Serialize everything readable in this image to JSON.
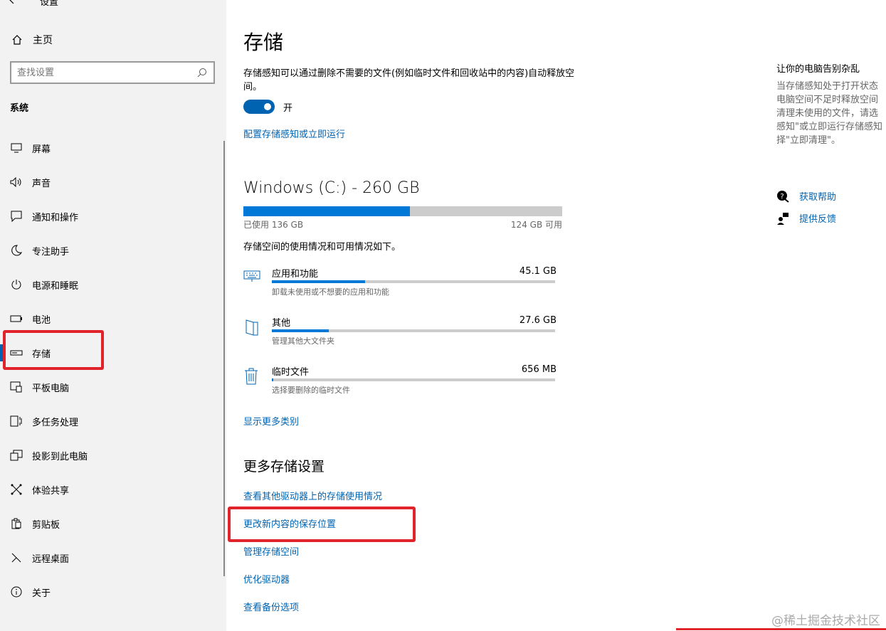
{
  "window": {
    "title": "设置"
  },
  "sidebar": {
    "home_label": "主页",
    "search_placeholder": "查找设置",
    "section_title": "系统",
    "items": [
      {
        "label": "屏幕",
        "icon": "monitor-icon"
      },
      {
        "label": "声音",
        "icon": "speaker-icon"
      },
      {
        "label": "通知和操作",
        "icon": "notification-icon"
      },
      {
        "label": "专注助手",
        "icon": "moon-icon"
      },
      {
        "label": "电源和睡眠",
        "icon": "power-icon"
      },
      {
        "label": "电池",
        "icon": "battery-icon"
      },
      {
        "label": "存储",
        "icon": "storage-icon",
        "active": true
      },
      {
        "label": "平板电脑",
        "icon": "tablet-icon"
      },
      {
        "label": "多任务处理",
        "icon": "multitask-icon"
      },
      {
        "label": "投影到此电脑",
        "icon": "project-icon"
      },
      {
        "label": "体验共享",
        "icon": "share-icon"
      },
      {
        "label": "剪贴板",
        "icon": "clipboard-icon"
      },
      {
        "label": "远程桌面",
        "icon": "remote-icon"
      },
      {
        "label": "关于",
        "icon": "info-icon"
      }
    ]
  },
  "main": {
    "title": "存储",
    "storage_sense_desc": "存储感知可以通过删除不需要的文件(例如临时文件和回收站中的内容)自动释放空间。",
    "toggle_state": "开",
    "config_link": "配置存储感知或立即运行",
    "drive": {
      "title": "Windows (C:) - 260 GB",
      "used_label": "已使用 136 GB",
      "free_label": "124 GB 可用",
      "used_fraction": 0.523
    },
    "usage_desc": "存储空间的使用情况和可用情况如下。",
    "categories": [
      {
        "name": "应用和功能",
        "size": "45.1 GB",
        "sub": "卸载未使用或不想要的应用和功能",
        "fraction": 0.33,
        "icon": "keyboard-icon"
      },
      {
        "name": "其他",
        "size": "27.6 GB",
        "sub": "管理其他大文件夹",
        "fraction": 0.2,
        "icon": "folder-icon"
      },
      {
        "name": "临时文件",
        "size": "656 MB",
        "sub": "选择要删除的临时文件",
        "fraction": 0.005,
        "icon": "trash-icon"
      }
    ],
    "show_more": "显示更多类别",
    "more_title": "更多存储设置",
    "more_links": [
      "查看其他驱动器上的存储使用情况",
      "更改新内容的保存位置",
      "管理存储空间",
      "优化驱动器",
      "查看备份选项"
    ]
  },
  "right": {
    "title": "让你的电脑告别杂乱",
    "desc_lines": [
      "当存储感知处于打开状态",
      "电脑空间不足时释放空间",
      "清理未使用的文件，请选",
      "感知\"或立即运行存储感知",
      "择\"立即清理\"。"
    ],
    "help_link": "获取帮助",
    "feedback_link": "提供反馈"
  },
  "watermark": "@稀土掘金技术社区",
  "colors": {
    "accent": "#0063b1",
    "bar": "#0078d7",
    "highlight": "#e1242b"
  }
}
